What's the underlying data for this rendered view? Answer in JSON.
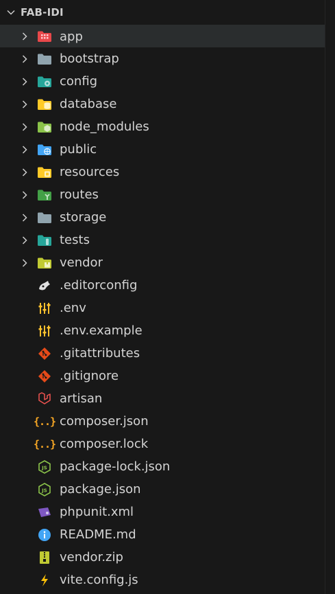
{
  "explorer": {
    "section_title": "FAB-IDI",
    "items": [
      {
        "label": "app",
        "kind": "folder",
        "icon": "folder-app-icon",
        "color": "#e8484a"
      },
      {
        "label": "bootstrap",
        "kind": "folder",
        "icon": "folder-icon",
        "color": "#90a4ae"
      },
      {
        "label": "config",
        "kind": "folder",
        "icon": "folder-config-icon",
        "color": "#26a69a"
      },
      {
        "label": "database",
        "kind": "folder",
        "icon": "folder-database-icon",
        "color": "#ffca28"
      },
      {
        "label": "node_modules",
        "kind": "folder",
        "icon": "folder-node-icon",
        "color": "#8bc34a"
      },
      {
        "label": "public",
        "kind": "folder",
        "icon": "folder-public-icon",
        "color": "#42a5f5"
      },
      {
        "label": "resources",
        "kind": "folder",
        "icon": "folder-resources-icon",
        "color": "#ffca28"
      },
      {
        "label": "routes",
        "kind": "folder",
        "icon": "folder-routes-icon",
        "color": "#43a047"
      },
      {
        "label": "storage",
        "kind": "folder",
        "icon": "folder-icon",
        "color": "#90a4ae"
      },
      {
        "label": "tests",
        "kind": "folder",
        "icon": "folder-test-icon",
        "color": "#26a69a"
      },
      {
        "label": "vendor",
        "kind": "folder",
        "icon": "folder-vendor-icon",
        "color": "#c0ca33"
      },
      {
        "label": ".editorconfig",
        "kind": "file",
        "icon": "editorconfig-icon",
        "color": "#e0e0e0"
      },
      {
        "label": ".env",
        "kind": "file",
        "icon": "env-settings-icon",
        "color": "#fbc02d"
      },
      {
        "label": ".env.example",
        "kind": "file",
        "icon": "env-settings-icon",
        "color": "#fbc02d"
      },
      {
        "label": ".gitattributes",
        "kind": "file",
        "icon": "git-icon",
        "color": "#e64a19"
      },
      {
        "label": ".gitignore",
        "kind": "file",
        "icon": "git-icon",
        "color": "#e64a19"
      },
      {
        "label": "artisan",
        "kind": "file",
        "icon": "laravel-icon",
        "color": "#ef5350"
      },
      {
        "label": "composer.json",
        "kind": "file",
        "icon": "json-braces-icon",
        "color": "#f9a825"
      },
      {
        "label": "composer.lock",
        "kind": "file",
        "icon": "json-braces-icon",
        "color": "#f9a825"
      },
      {
        "label": "package-lock.json",
        "kind": "file",
        "icon": "nodejs-icon",
        "color": "#8bc34a"
      },
      {
        "label": "package.json",
        "kind": "file",
        "icon": "nodejs-icon",
        "color": "#8bc34a"
      },
      {
        "label": "phpunit.xml",
        "kind": "file",
        "icon": "phpunit-icon",
        "color": "#7e57c2"
      },
      {
        "label": "README.md",
        "kind": "file",
        "icon": "info-icon",
        "color": "#42a5f5"
      },
      {
        "label": "vendor.zip",
        "kind": "file",
        "icon": "zip-icon",
        "color": "#c0ca33"
      },
      {
        "label": "vite.config.js",
        "kind": "file",
        "icon": "vite-icon",
        "color": "#ffc107"
      }
    ]
  }
}
